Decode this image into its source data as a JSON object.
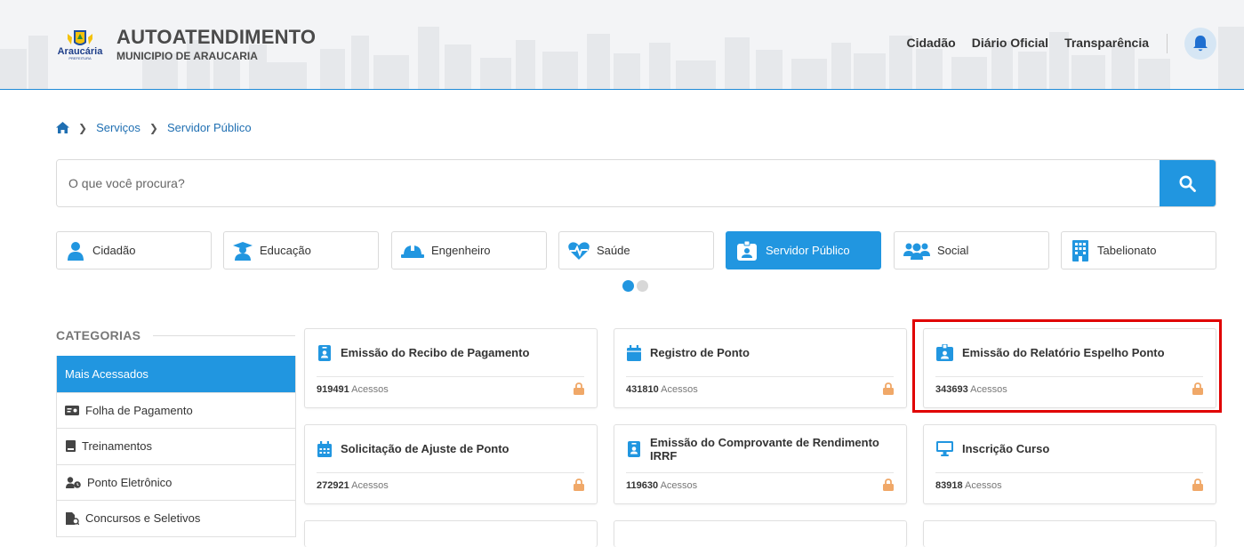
{
  "header": {
    "logo_text": "Araucária",
    "logo_sub": "PREFEITURA",
    "title": "AUTOATENDIMENTO",
    "subtitle": "MUNICIPIO DE ARAUCARIA",
    "nav": [
      "Cidadão",
      "Diário Oficial",
      "Transparência"
    ],
    "notification_icon": "bell-icon"
  },
  "breadcrumb": {
    "home_icon": "home-icon",
    "items": [
      "Serviços",
      "Servidor Público"
    ]
  },
  "search": {
    "placeholder": "O que você procura?",
    "value": "",
    "button_icon": "search-icon"
  },
  "profiles": [
    {
      "label": "Cidadão",
      "icon": "user-icon",
      "active": false
    },
    {
      "label": "Educação",
      "icon": "graduate-icon",
      "active": false
    },
    {
      "label": "Engenheiro",
      "icon": "hard-hat-icon",
      "active": false
    },
    {
      "label": "Saúde",
      "icon": "heartbeat-icon",
      "active": false
    },
    {
      "label": "Servidor Público",
      "icon": "id-badge-icon",
      "active": true
    },
    {
      "label": "Social",
      "icon": "users-icon",
      "active": false
    },
    {
      "label": "Tabelionato",
      "icon": "building-icon",
      "active": false
    }
  ],
  "carousel": {
    "pages": 2,
    "current": 1
  },
  "categories": {
    "title": "CATEGORIAS",
    "items": [
      {
        "label": "Mais Acessados",
        "icon": "",
        "active": true
      },
      {
        "label": "Folha de Pagamento",
        "icon": "money-bill-icon",
        "active": false
      },
      {
        "label": "Treinamentos",
        "icon": "book-icon",
        "active": false
      },
      {
        "label": "Ponto Eletrônico",
        "icon": "user-clock-icon",
        "active": false
      },
      {
        "label": "Concursos e Seletivos",
        "icon": "file-search-icon",
        "active": false
      }
    ]
  },
  "services": [
    {
      "title": "Emissão do Recibo de Pagamento",
      "count": "919491",
      "count_label": "Acessos",
      "icon": "id-badge-icon"
    },
    {
      "title": "Registro de Ponto",
      "count": "431810",
      "count_label": "Acessos",
      "icon": "calendar-icon"
    },
    {
      "title": "Emissão do Relatório Espelho Ponto",
      "count": "343693",
      "count_label": "Acessos",
      "icon": "id-card-icon",
      "highlighted": true
    },
    {
      "title": "Solicitação de Ajuste de Ponto",
      "count": "272921",
      "count_label": "Acessos",
      "icon": "calendar-grid-icon"
    },
    {
      "title": "Emissão do Comprovante de Rendimento IRRF",
      "count": "119630",
      "count_label": "Acessos",
      "icon": "id-badge-icon"
    },
    {
      "title": "Inscrição Curso",
      "count": "83918",
      "count_label": "Acessos",
      "icon": "desktop-icon"
    }
  ],
  "colors": {
    "accent": "#2196e0",
    "highlight": "#e00000",
    "lock": "#f0a868"
  }
}
